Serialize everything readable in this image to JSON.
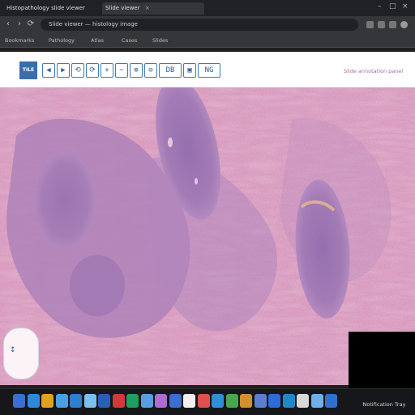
{
  "browser": {
    "tabs": [
      {
        "label": "Histopathology slide viewer",
        "active": false
      },
      {
        "label": "Slide viewer",
        "active": true
      },
      {
        "label": "",
        "active": false
      }
    ],
    "address": "Slide viewer — histology image",
    "bookmarks": [
      "Bookmarks",
      "Pathology",
      "Atlas",
      "Cases",
      "Slides"
    ]
  },
  "viewer": {
    "logo_text": "TILE",
    "tools": [
      "◀",
      "▶",
      "⟲",
      "⟳",
      "+",
      "−",
      "⊕",
      "⊖",
      "▣",
      "◐",
      "◑",
      "⊞"
    ],
    "wide_tools": [
      "DB",
      "NG"
    ],
    "right_text": "Slide annotation panel"
  },
  "overview": {
    "marker": "↕"
  },
  "taskbar": {
    "icon_colors": [
      "#3b6fd1",
      "#2d8ad8",
      "#e0a020",
      "#4aa0e0",
      "#2f7fd0",
      "#7cc0f0",
      "#2a5fb8",
      "#d03a3a",
      "#1f9f5f",
      "#5a9de0",
      "#b06ad0",
      "#3b6fd1",
      "#f0f0f0",
      "#e05050",
      "#2f8fd8",
      "#46a84e",
      "#d09030",
      "#5a7fd0",
      "#2d6bd8",
      "#1f88c8",
      "#d8d8d8",
      "#6fb0e8",
      "#2f6fd0"
    ],
    "clock": "Notification Tray"
  },
  "colors": {
    "stroma": "#e6a5bf",
    "nodule": "#9b79b5",
    "nodule_dark": "#7e5fa3",
    "accent": "#3b7bb8"
  }
}
